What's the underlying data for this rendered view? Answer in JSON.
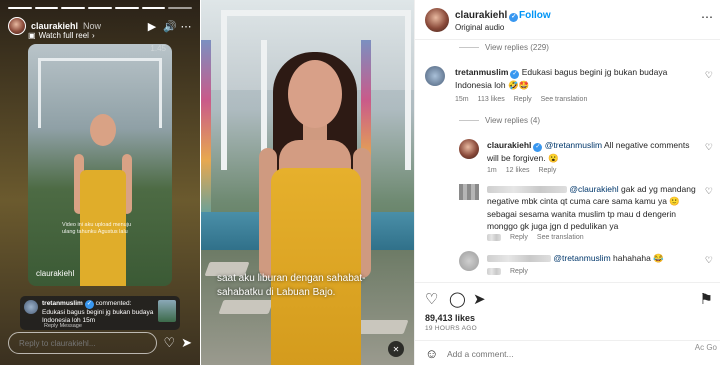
{
  "story": {
    "username": "claurakiehl",
    "time": "Now",
    "watch_full_reel": "Watch full reel",
    "card_watermark": "1.45",
    "card_caption": "Video ini aku upload menuju ulang tahunku Agustus lalu",
    "card_brand": "claurakiehl",
    "comment": {
      "username": "tretanmuslim",
      "action": "commented: Edukasi bagus begini jg bukan budaya Indonesia loh",
      "time": "15m",
      "meta": "Reply  Message"
    },
    "reply_placeholder": "Reply to claurakiehl...",
    "tag_text": "@tretan mu..."
  },
  "reel": {
    "subtitle": "saat aku liburan dengan sahabat-sahabatku di Labuan Bajo."
  },
  "panel": {
    "username": "claurakiehl",
    "follow": "Follow",
    "audio": "Original audio",
    "view_replies_1": "View replies (229)",
    "comment1": {
      "username": "tretanmuslim",
      "text": "Edukasi bagus begini jg bukan budaya Indonesia loh",
      "emoji": "🤣🤩",
      "time": "15m",
      "likes": "113 likes",
      "reply": "Reply",
      "translate": "See translation"
    },
    "view_replies_2": "View replies (4)",
    "reply1": {
      "username": "claurakiehl",
      "mention": "@tretanmuslim",
      "text": "All negative comments will be forgiven.",
      "emoji": "😮",
      "time": "1m",
      "likes": "12 likes",
      "reply": "Reply"
    },
    "reply2": {
      "mention": "@claurakiehl",
      "text_a": "gak ad yg mandang negative mbk cinta qt cuma care sama kamu ya",
      "emoji": "🙂",
      "text_b": "sebagai sesama wanita muslim tp mau d dengerin monggo gk juga jgn d pedulikan ya",
      "reply": "Reply",
      "translate": "See translation"
    },
    "reply3": {
      "mention": "@tretanmuslim",
      "text": "hahahaha",
      "emoji": "😂",
      "reply": "Reply"
    },
    "likes_count": "89,413 likes",
    "time_ago": "19 HOURS AGO",
    "add_comment_placeholder": "Add a comment...",
    "side_text": "Ac Go"
  }
}
